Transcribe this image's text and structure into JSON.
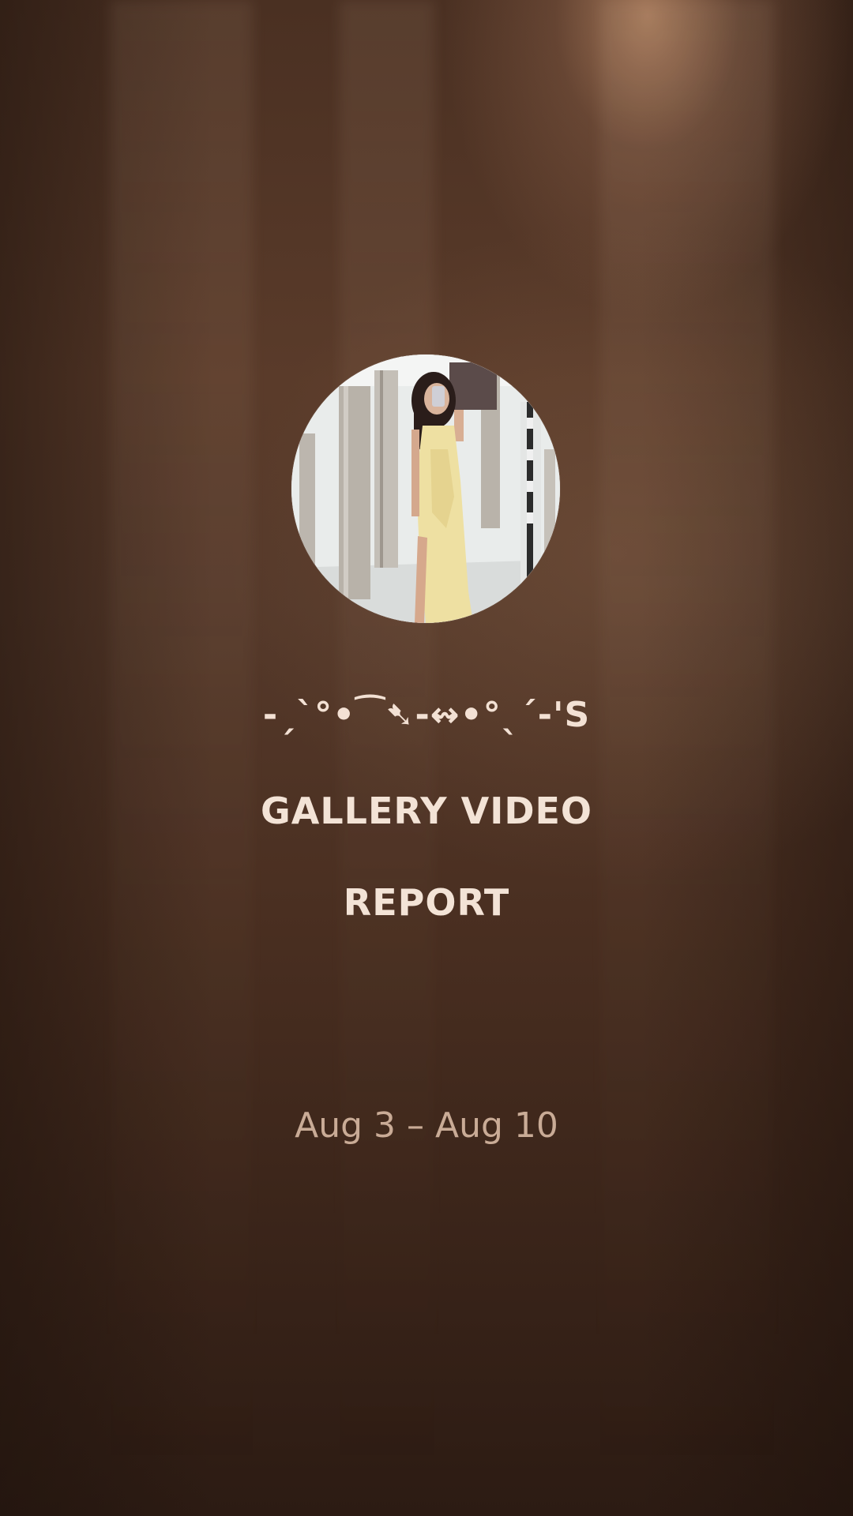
{
  "profile": {
    "name": "-ˏˋ°•⁀➷-↭•°ˎˊ-'S",
    "avatar_icon": "profile-photo"
  },
  "report": {
    "title_line1": "GALLERY VIDEO",
    "title_line2": "REPORT",
    "date_range": "Aug 3 – Aug 10"
  },
  "colors": {
    "background": "#4a3022",
    "title_text": "#f3e3d6",
    "date_text": "#c9ab96"
  }
}
